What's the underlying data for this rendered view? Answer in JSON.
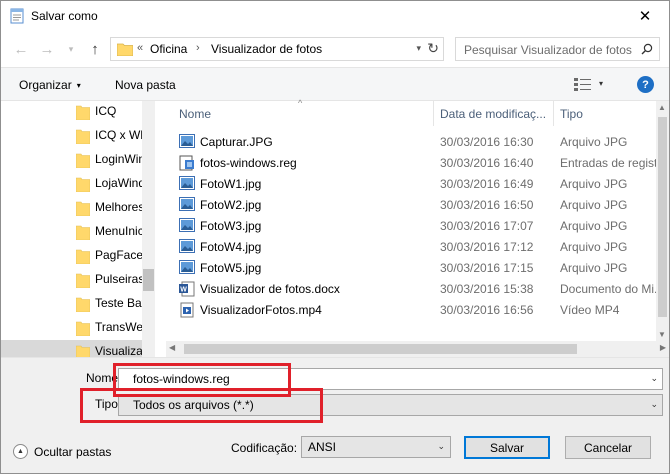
{
  "window": {
    "title": "Salvar como",
    "close_glyph": "✕"
  },
  "nav": {
    "back": "←",
    "forward": "→",
    "recent_dropdown": "▾",
    "up": "↑",
    "address": {
      "overflow": "«",
      "items": [
        "Oficina",
        "Visualizador de fotos"
      ],
      "separator": "›",
      "dropdown": "▾",
      "refresh": "↻"
    },
    "search": {
      "placeholder": "Pesquisar Visualizador de fotos"
    }
  },
  "toolbar": {
    "organize": "Organizar",
    "organize_caret": "▾",
    "new_folder": "Nova pasta",
    "view_caret": "▾",
    "help": "?"
  },
  "tree": {
    "items": [
      {
        "label": "ICQ"
      },
      {
        "label": "ICQ x WhatsApp"
      },
      {
        "label": "LoginWindows"
      },
      {
        "label": "LojaWindows"
      },
      {
        "label": "Melhores"
      },
      {
        "label": "MenuIniciar"
      },
      {
        "label": "PagFace"
      },
      {
        "label": "Pulseiras"
      },
      {
        "label": "Teste Bateria"
      },
      {
        "label": "TransWeb"
      },
      {
        "label": "Visualizador"
      }
    ],
    "selected_index": 10
  },
  "columns": {
    "name": "Nome",
    "date": "Data de modificaç...",
    "type": "Tipo",
    "sort_glyph": "^"
  },
  "files": [
    {
      "name": "Capturar.JPG",
      "date": "30/03/2016 16:30",
      "type": "Arquivo JPG",
      "icon": "image-icon"
    },
    {
      "name": "fotos-windows.reg",
      "date": "30/03/2016 16:40",
      "type": "Entradas de registro",
      "icon": "registry-icon"
    },
    {
      "name": "FotoW1.jpg",
      "date": "30/03/2016 16:49",
      "type": "Arquivo JPG",
      "icon": "image-icon"
    },
    {
      "name": "FotoW2.jpg",
      "date": "30/03/2016 16:50",
      "type": "Arquivo JPG",
      "icon": "image-icon"
    },
    {
      "name": "FotoW3.jpg",
      "date": "30/03/2016 17:07",
      "type": "Arquivo JPG",
      "icon": "image-icon"
    },
    {
      "name": "FotoW4.jpg",
      "date": "30/03/2016 17:12",
      "type": "Arquivo JPG",
      "icon": "image-icon"
    },
    {
      "name": "FotoW5.jpg",
      "date": "30/03/2016 17:15",
      "type": "Arquivo JPG",
      "icon": "image-icon"
    },
    {
      "name": "Visualizador de fotos.docx",
      "date": "30/03/2016 15:38",
      "type": "Documento do Mi...",
      "icon": "word-doc-icon"
    },
    {
      "name": "VisualizadorFotos.mp4",
      "date": "30/03/2016 16:56",
      "type": "Vídeo MP4",
      "icon": "video-icon"
    }
  ],
  "form": {
    "name_label": "Nome:",
    "name_value": "fotos-windows.reg",
    "type_label": "Tipo:",
    "type_value": "Todos os arquivos  (*.*)",
    "dropdown_glyph": "⌄"
  },
  "footer": {
    "hide_folders": "Ocultar pastas",
    "hide_glyph": "▲",
    "encoding_label": "Codificação:",
    "encoding_value": "ANSI",
    "save": "Salvar",
    "cancel": "Cancelar"
  },
  "colors": {
    "highlight": "#e0202a",
    "accent": "#0078d7",
    "folder": "#ffd86b"
  }
}
